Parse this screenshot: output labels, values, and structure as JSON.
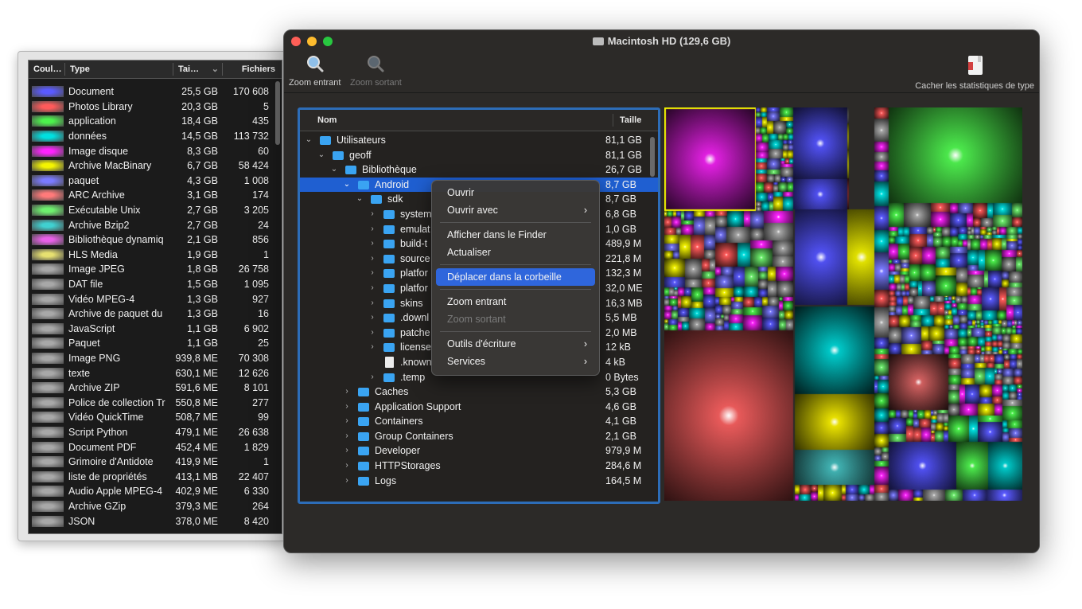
{
  "window": {
    "title": "Macintosh HD (129,6 GB)"
  },
  "toolbar": {
    "zoom_in": "Zoom entrant",
    "zoom_out": "Zoom sortant",
    "hide_stats": "Cacher les statistiques de type"
  },
  "stats": {
    "headers": {
      "color": "Coul…",
      "type": "Type",
      "size": "Tai…",
      "files": "Fichiers"
    },
    "rows": [
      {
        "color": "#5a5aff",
        "type": "Document",
        "size": "25,5 GB",
        "files": "170 608"
      },
      {
        "color": "#ff5a5a",
        "type": "Photos Library",
        "size": "20,3 GB",
        "files": "5"
      },
      {
        "color": "#4cf24c",
        "type": "application",
        "size": "18,4 GB",
        "files": "435"
      },
      {
        "color": "#00e0e0",
        "type": "données",
        "size": "14,5 GB",
        "files": "113 732"
      },
      {
        "color": "#ff22ff",
        "type": "Image disque",
        "size": "8,3 GB",
        "files": "60"
      },
      {
        "color": "#f4f400",
        "type": "Archive MacBinary",
        "size": "6,7 GB",
        "files": "58 424"
      },
      {
        "color": "#7a7aff",
        "type": "paquet",
        "size": "4,3 GB",
        "files": "1 008"
      },
      {
        "color": "#ff7a7a",
        "type": "ARC Archive",
        "size": "3,1 GB",
        "files": "174"
      },
      {
        "color": "#6ef06e",
        "type": "Exécutable Unix",
        "size": "2,7 GB",
        "files": "3 205"
      },
      {
        "color": "#40d0d0",
        "type": "Archive Bzip2",
        "size": "2,7 GB",
        "files": "24"
      },
      {
        "color": "#e860e8",
        "type": "Bibliothèque dynamiq",
        "size": "2,1 GB",
        "files": "856"
      },
      {
        "color": "#e6e070",
        "type": "HLS Media",
        "size": "1,9 GB",
        "files": "1"
      },
      {
        "color": "#a8a8a8",
        "type": "Image JPEG",
        "size": "1,8 GB",
        "files": "26 758"
      },
      {
        "color": "#a8a8a8",
        "type": "DAT file",
        "size": "1,5 GB",
        "files": "1 095"
      },
      {
        "color": "#a8a8a8",
        "type": "Vidéo MPEG-4",
        "size": "1,3 GB",
        "files": "927"
      },
      {
        "color": "#a8a8a8",
        "type": "Archive de paquet du",
        "size": "1,3 GB",
        "files": "16"
      },
      {
        "color": "#a8a8a8",
        "type": "JavaScript",
        "size": "1,1 GB",
        "files": "6 902"
      },
      {
        "color": "#a8a8a8",
        "type": "Paquet",
        "size": "1,1 GB",
        "files": "25"
      },
      {
        "color": "#a8a8a8",
        "type": "Image PNG",
        "size": "939,8 ME",
        "files": "70 308"
      },
      {
        "color": "#a8a8a8",
        "type": "texte",
        "size": "630,1 ME",
        "files": "12 626"
      },
      {
        "color": "#a8a8a8",
        "type": "Archive ZIP",
        "size": "591,6 ME",
        "files": "8 101"
      },
      {
        "color": "#a8a8a8",
        "type": "Police de collection Tr",
        "size": "550,8 ME",
        "files": "277"
      },
      {
        "color": "#a8a8a8",
        "type": "Vidéo QuickTime",
        "size": "508,7 ME",
        "files": "99"
      },
      {
        "color": "#a8a8a8",
        "type": "Script Python",
        "size": "479,1 ME",
        "files": "26 638"
      },
      {
        "color": "#a8a8a8",
        "type": "Document PDF",
        "size": "452,4 ME",
        "files": "1 829"
      },
      {
        "color": "#a8a8a8",
        "type": "Grimoire d'Antidote",
        "size": "419,9 ME",
        "files": "1"
      },
      {
        "color": "#a8a8a8",
        "type": "liste de propriétés",
        "size": "413,1 MB",
        "files": "22 407"
      },
      {
        "color": "#a8a8a8",
        "type": "Audio Apple MPEG-4",
        "size": "402,9 ME",
        "files": "6 330"
      },
      {
        "color": "#a8a8a8",
        "type": "Archive GZip",
        "size": "379,3 ME",
        "files": "264"
      },
      {
        "color": "#a8a8a8",
        "type": "JSON",
        "size": "378,0 ME",
        "files": "8 420"
      }
    ]
  },
  "tree": {
    "headers": {
      "name": "Nom",
      "size": "Taille"
    },
    "rows": [
      {
        "name": "Utilisateurs",
        "size": "81,1 GB",
        "depth": 0,
        "chevron": "⌄",
        "icon": "folder"
      },
      {
        "name": "geoff",
        "size": "81,1 GB",
        "depth": 1,
        "chevron": "⌄",
        "icon": "folder"
      },
      {
        "name": "Bibliothèque",
        "size": "26,7 GB",
        "depth": 2,
        "chevron": "⌄",
        "icon": "folder"
      },
      {
        "name": "Android",
        "size": "8,7 GB",
        "depth": 3,
        "chevron": "⌄",
        "icon": "folder",
        "selected": true
      },
      {
        "name": "sdk",
        "size": "8,7 GB",
        "depth": 4,
        "chevron": "⌄",
        "icon": "folder"
      },
      {
        "name": "system",
        "size": "6,8 GB",
        "depth": 5,
        "chevron": "›",
        "icon": "folder"
      },
      {
        "name": "emulat",
        "size": "1,0 GB",
        "depth": 5,
        "chevron": "›",
        "icon": "folder"
      },
      {
        "name": "build-t",
        "size": "489,9 M",
        "depth": 5,
        "chevron": "›",
        "icon": "folder"
      },
      {
        "name": "source",
        "size": "221,8 M",
        "depth": 5,
        "chevron": "›",
        "icon": "folder"
      },
      {
        "name": "platfor",
        "size": "132,3 M",
        "depth": 5,
        "chevron": "›",
        "icon": "folder"
      },
      {
        "name": "platfor",
        "size": "32,0 ME",
        "depth": 5,
        "chevron": "›",
        "icon": "folder"
      },
      {
        "name": "skins",
        "size": "16,3 MB",
        "depth": 5,
        "chevron": "›",
        "icon": "folder"
      },
      {
        "name": ".downl",
        "size": "5,5 MB",
        "depth": 5,
        "chevron": "›",
        "icon": "folder"
      },
      {
        "name": "patche",
        "size": "2,0 MB",
        "depth": 5,
        "chevron": "›",
        "icon": "folder"
      },
      {
        "name": "license",
        "size": "12 kB",
        "depth": 5,
        "chevron": "›",
        "icon": "folder"
      },
      {
        "name": ".known",
        "size": "4 kB",
        "depth": 5,
        "chevron": "",
        "icon": "doc"
      },
      {
        "name": ".temp",
        "size": "0 Bytes",
        "depth": 5,
        "chevron": "›",
        "icon": "folder"
      },
      {
        "name": "Caches",
        "size": "5,3 GB",
        "depth": 3,
        "chevron": "›",
        "icon": "folder"
      },
      {
        "name": "Application Support",
        "size": "4,6 GB",
        "depth": 3,
        "chevron": "›",
        "icon": "folder"
      },
      {
        "name": "Containers",
        "size": "4,1 GB",
        "depth": 3,
        "chevron": "›",
        "icon": "folder"
      },
      {
        "name": "Group Containers",
        "size": "2,1 GB",
        "depth": 3,
        "chevron": "›",
        "icon": "folder"
      },
      {
        "name": "Developer",
        "size": "979,9 M",
        "depth": 3,
        "chevron": "›",
        "icon": "folder"
      },
      {
        "name": "HTTPStorages",
        "size": "284,6 M",
        "depth": 3,
        "chevron": "›",
        "icon": "folder"
      },
      {
        "name": "Logs",
        "size": "164,5 M",
        "depth": 3,
        "chevron": "›",
        "icon": "folder"
      }
    ]
  },
  "context_menu": {
    "items": [
      {
        "label": "Ouvrir",
        "submenu": false,
        "disabled": false,
        "highlighted": false
      },
      {
        "label": "Ouvrir avec",
        "submenu": true,
        "disabled": false,
        "highlighted": false
      },
      {
        "separator": true
      },
      {
        "label": "Afficher dans le Finder",
        "submenu": false,
        "disabled": false,
        "highlighted": false
      },
      {
        "label": "Actualiser",
        "submenu": false,
        "disabled": false,
        "highlighted": false
      },
      {
        "separator": true
      },
      {
        "label": "Déplacer dans la corbeille",
        "submenu": false,
        "disabled": false,
        "highlighted": true
      },
      {
        "separator": true
      },
      {
        "label": "Zoom entrant",
        "submenu": false,
        "disabled": false,
        "highlighted": false
      },
      {
        "label": "Zoom sortant",
        "submenu": false,
        "disabled": true,
        "highlighted": false
      },
      {
        "separator": true
      },
      {
        "label": "Outils d'écriture",
        "submenu": true,
        "disabled": false,
        "highlighted": false
      },
      {
        "label": "Services",
        "submenu": true,
        "disabled": false,
        "highlighted": false
      }
    ]
  },
  "colors": {
    "accent": "#2f66dc",
    "selection": "#1f5fd1",
    "focus_ring": "#2d6db8",
    "traffic_close": "#ff5f57",
    "traffic_min": "#febc2e",
    "traffic_max": "#28c840"
  }
}
